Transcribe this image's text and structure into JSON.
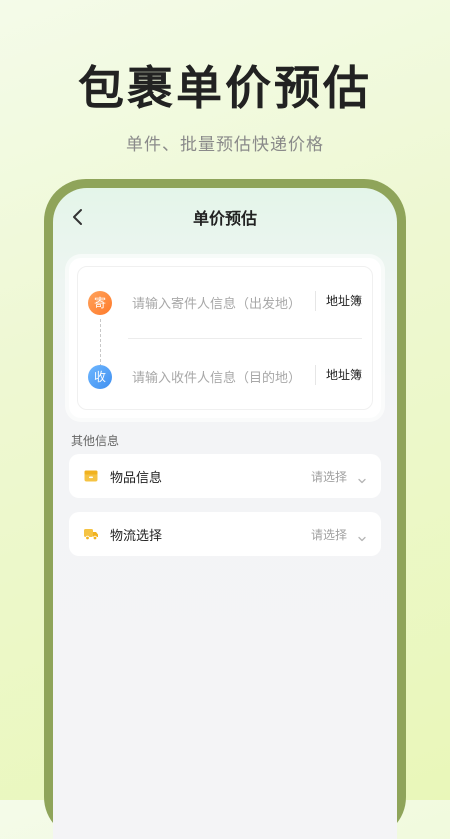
{
  "hero": {
    "title": "包裹单价预估",
    "subtitle": "单件、批量预估快递价格"
  },
  "nav": {
    "title": "单价预估",
    "back_icon": "chevron-left-icon"
  },
  "address": {
    "sender": {
      "badge": "寄",
      "placeholder": "请输入寄件人信息（出发地）",
      "book_label": "地址簿",
      "badge_color": "#ff8a3c"
    },
    "receiver": {
      "badge": "收",
      "placeholder": "请输入收件人信息（目的地）",
      "book_label": "地址簿",
      "badge_color": "#4b98f2"
    }
  },
  "other": {
    "section_label": "其他信息",
    "goods": {
      "label": "物品信息",
      "value": "请选择",
      "icon": "box-icon"
    },
    "logistics": {
      "label": "物流选择",
      "value": "请选择",
      "icon": "truck-icon"
    }
  },
  "colors": {
    "phone_frame": "#8fa45a",
    "accent_icon": "#f5c343"
  }
}
